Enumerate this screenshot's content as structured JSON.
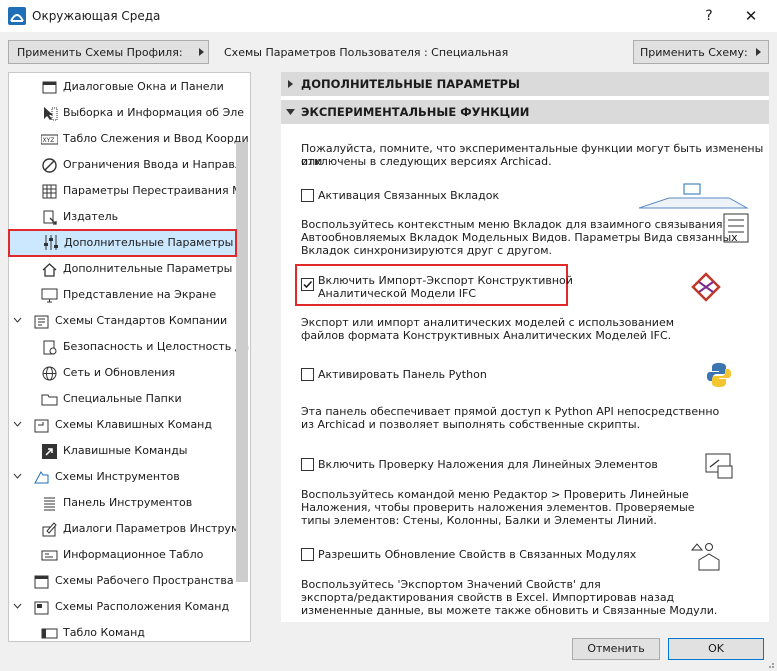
{
  "window": {
    "title": "Окружающая Среда",
    "help": "?",
    "close": "✕"
  },
  "toolbar": {
    "apply_profile": "Применить Схемы Профиля:",
    "user_scheme_label": "Схемы Параметров Пользователя :  Специальная",
    "apply_scheme": "Применить Схему:"
  },
  "tree": {
    "items": [
      {
        "label": "Диалоговые Окна и Панели"
      },
      {
        "label": "Выборка и Информация об Эле"
      },
      {
        "label": "Табло Слежения и Ввод Коорди"
      },
      {
        "label": "Ограничения Ввода и Направля"
      },
      {
        "label": "Параметры Перестраивания Мо"
      },
      {
        "label": "Издатель"
      },
      {
        "label": "Дополнительные Параметры"
      },
      {
        "label": "Дополнительные Параметры О"
      },
      {
        "label": "Представление на Экране"
      },
      {
        "label": "Схемы Стандартов Компании"
      },
      {
        "label": "Безопасность и Целостность да"
      },
      {
        "label": "Сеть и Обновления"
      },
      {
        "label": "Специальные Папки"
      },
      {
        "label": "Схемы Клавишных Команд"
      },
      {
        "label": "Клавишные Команды"
      },
      {
        "label": "Схемы Инструментов"
      },
      {
        "label": "Панель Инструментов"
      },
      {
        "label": "Диалоги Параметров Инструме"
      },
      {
        "label": "Информационное Табло"
      },
      {
        "label": "Схемы Рабочего Пространства"
      },
      {
        "label": "Схемы Расположения Команд"
      },
      {
        "label": "Табло Команд"
      }
    ]
  },
  "content": {
    "section_more": "ДОПОЛНИТЕЛЬНЫЕ ПАРАМЕТРЫ",
    "section_experimental": "ЭКСПЕРИМЕНТАЛЬНЫЕ ФУНКЦИИ",
    "intro_1": "Пожалуйста, помните, что экспериментальные функции могут быть изменены или",
    "intro_2": "отключены в следующих версиях Archicad.",
    "opt1_label": "Активация Связанных Вкладок",
    "opt1_d1": "Воспользуйтесь контекстным меню Вкладок для взаимного связывания",
    "opt1_d2": "Автообновляемых Вкладок Модельных Видов. Параметры Вида связанных",
    "opt1_d3": "Вкладок синхронизируются друг с другом.",
    "opt2_label_1": "Включить Импорт-Экспорт Конструктивной",
    "opt2_label_2": "Аналитической Модели IFC",
    "opt2_d1": "Экспорт или импорт аналитических моделей с использованием",
    "opt2_d2": "файлов формата Конструктивных Аналитических Моделей IFC.",
    "opt3_label": "Активировать Панель Python",
    "opt3_d1": "Эта панель обеспечивает прямой доступ к Python API непосредственно",
    "opt3_d2": "из Archicad и позволяет выполнять собственные скрипты.",
    "opt4_label": "Включить Проверку Наложения для Линейных Элементов",
    "opt4_d1": "Воспользуйтесь командой меню Редактор > Проверить Линейные",
    "opt4_d2": "Наложения, чтобы проверить наложения элементов. Проверяемые",
    "opt4_d3": "типы элементов: Стены, Колонны, Балки и Элементы Линий.",
    "opt5_label": "Разрешить Обновление Свойств в Связанных Модулях",
    "opt5_d1": "Воспользуйтесь 'Экспортом Значений Свойств' для",
    "opt5_d2": "экспорта/редактирования свойств в Excel. Импортировав назад",
    "opt5_d3": "измененные данные, вы можете также обновить и Связанные Модули."
  },
  "checkboxes": {
    "opt1": false,
    "opt2": true,
    "opt3": false,
    "opt4": false,
    "opt5": false
  },
  "footer": {
    "cancel": "Отменить",
    "ok": "OK"
  },
  "colors": {
    "highlight": "#e0292b",
    "selection": "#cce8ff",
    "accent": "#0078d7"
  }
}
